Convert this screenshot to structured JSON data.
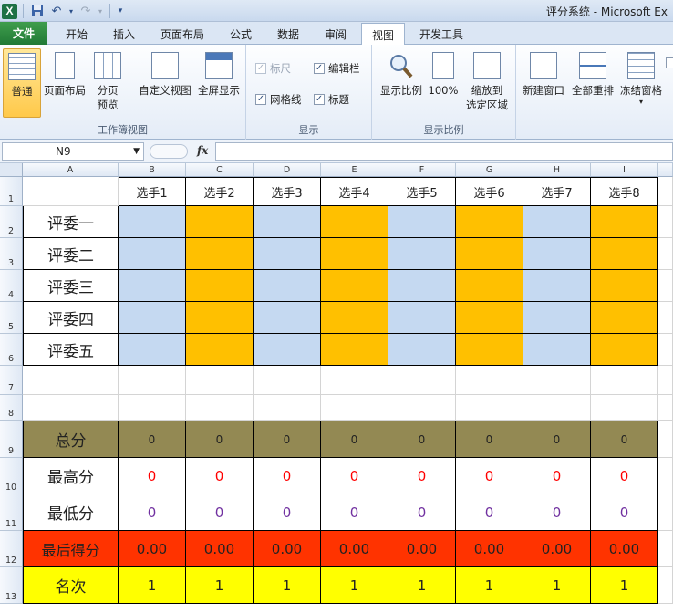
{
  "window": {
    "title": "评分系统 - Microsoft Ex",
    "app_icon": "X"
  },
  "tabs": [
    {
      "label": "文件"
    },
    {
      "label": "开始"
    },
    {
      "label": "插入"
    },
    {
      "label": "页面布局"
    },
    {
      "label": "公式"
    },
    {
      "label": "数据"
    },
    {
      "label": "审阅"
    },
    {
      "label": "视图"
    },
    {
      "label": "开发工具"
    }
  ],
  "ribbon": {
    "workbook_views": {
      "label": "工作簿视图",
      "normal": "普通",
      "page_layout": "页面布局",
      "page_break_1": "分页",
      "page_break_2": "预览",
      "custom_views": "自定义视图",
      "full_screen": "全屏显示"
    },
    "show": {
      "label": "显示",
      "ruler": "标尺",
      "formula_bar": "编辑栏",
      "gridlines": "网格线",
      "headings": "标题"
    },
    "zoom": {
      "label": "显示比例",
      "zoom": "显示比例",
      "hundred": "100%",
      "zoom_sel_1": "缩放到",
      "zoom_sel_2": "选定区域"
    },
    "window": {
      "new_window": "新建窗口",
      "arrange_all": "全部重排",
      "freeze": "冻结窗格"
    }
  },
  "formula_bar": {
    "name_box": "N9",
    "fx": "fx",
    "value": ""
  },
  "sheet": {
    "columns": [
      "A",
      "B",
      "C",
      "D",
      "E",
      "F",
      "G",
      "H",
      "I"
    ],
    "rows": [
      "1",
      "2",
      "3",
      "4",
      "5",
      "6",
      "7",
      "8",
      "9",
      "10",
      "11",
      "12",
      "13"
    ],
    "players": [
      "选手1",
      "选手2",
      "选手3",
      "选手4",
      "选手5",
      "选手6",
      "选手7",
      "选手8"
    ],
    "judges": [
      "评委一",
      "评委二",
      "评委三",
      "评委四",
      "评委五"
    ],
    "summary_labels": {
      "total": "总分",
      "max": "最高分",
      "min": "最低分",
      "final": "最后得分",
      "rank": "名次"
    },
    "totals": [
      "0",
      "0",
      "0",
      "0",
      "0",
      "0",
      "0",
      "0"
    ],
    "max_scores": [
      "0",
      "0",
      "0",
      "0",
      "0",
      "0",
      "0",
      "0"
    ],
    "min_scores": [
      "0",
      "0",
      "0",
      "0",
      "0",
      "0",
      "0",
      "0"
    ],
    "final_scores": [
      "0.00",
      "0.00",
      "0.00",
      "0.00",
      "0.00",
      "0.00",
      "0.00",
      "0.00"
    ],
    "ranks": [
      "1",
      "1",
      "1",
      "1",
      "1",
      "1",
      "1",
      "1"
    ]
  },
  "colors": {
    "blue_cell": "#c5d9f1",
    "orange_cell": "#ffc000",
    "total_row": "#938953",
    "final_row": "#ff3300",
    "rank_row": "#ffff00",
    "max_text": "#ff0000",
    "min_text": "#7030a0"
  }
}
